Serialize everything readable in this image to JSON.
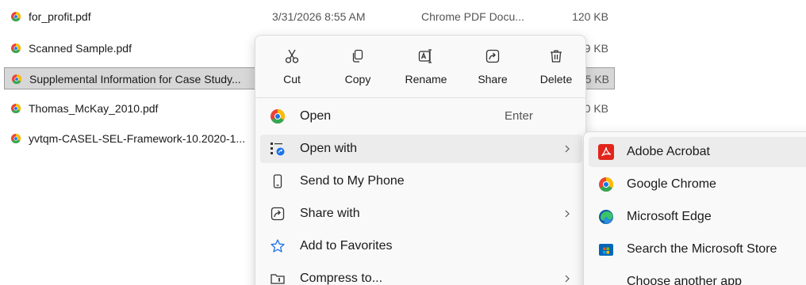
{
  "files": [
    {
      "name": "for_profit.pdf",
      "date": "3/31/2026 8:55 AM",
      "type": "Chrome PDF Docu...",
      "size": "120 KB",
      "selected": false
    },
    {
      "name": "Scanned Sample.pdf",
      "size": "9 KB",
      "selected": false
    },
    {
      "name": "Supplemental Information for Case Study...",
      "size": "5 KB",
      "selected": true
    },
    {
      "name": "Thomas_McKay_2010.pdf",
      "size": "0 KB",
      "selected": false
    },
    {
      "name": "yvtqm-CASEL-SEL-Framework-10.2020-1...",
      "selected": false
    }
  ],
  "context_menu": {
    "quick_actions": [
      {
        "label": "Cut",
        "icon": "scissors-icon"
      },
      {
        "label": "Copy",
        "icon": "copy-icon"
      },
      {
        "label": "Rename",
        "icon": "rename-icon"
      },
      {
        "label": "Share",
        "icon": "share-icon"
      },
      {
        "label": "Delete",
        "icon": "trash-icon"
      }
    ],
    "items": [
      {
        "label": "Open",
        "icon": "chrome-icon",
        "shortcut": "Enter"
      },
      {
        "label": "Open with",
        "icon": "open-with-icon",
        "has_submenu": true,
        "highlighted": true
      },
      {
        "label": "Send to My Phone",
        "icon": "phone-icon"
      },
      {
        "label": "Share with",
        "icon": "share-icon",
        "has_submenu": true
      },
      {
        "label": "Add to Favorites",
        "icon": "star-icon"
      },
      {
        "label": "Compress to...",
        "icon": "zip-folder-icon",
        "has_submenu": true
      }
    ]
  },
  "submenu": {
    "items": [
      {
        "label": "Adobe Acrobat",
        "icon": "adobe-acrobat-icon",
        "highlighted": true
      },
      {
        "label": "Google Chrome",
        "icon": "chrome-icon"
      },
      {
        "label": "Microsoft Edge",
        "icon": "edge-icon"
      },
      {
        "label": "Search the Microsoft Store",
        "icon": "store-icon"
      },
      {
        "label": "Choose another app",
        "icon": ""
      }
    ]
  },
  "colors": {
    "selection_bg": "#d7d7d7",
    "menu_bg": "#f9f9f9",
    "hover_bg": "#ececec",
    "acrobat_red": "#e1251b",
    "store_blue": "#0067b8"
  }
}
